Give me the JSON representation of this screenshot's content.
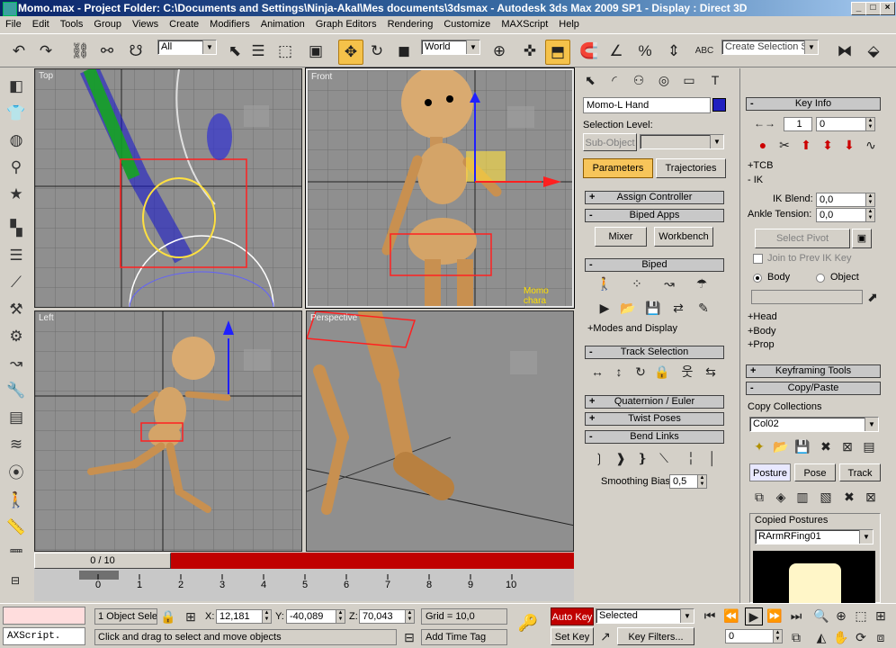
{
  "window": {
    "title": "Momo.max    - Project Folder: C:\\Documents and Settings\\Ninja-Akal\\Mes documents\\3dsmax    - Autodesk 3ds Max  2009 SP1       - Display : Direct 3D",
    "controls": [
      "_",
      "□",
      "×"
    ]
  },
  "menu": [
    "File",
    "Edit",
    "Tools",
    "Group",
    "Views",
    "Create",
    "Modifiers",
    "Animation",
    "Graph Editors",
    "Rendering",
    "Customize",
    "MAXScript",
    "Help"
  ],
  "toolbar": {
    "selection_filter": "All",
    "reference_coord": "World",
    "named_selection_placeholder": "Create Selection Set"
  },
  "viewports": {
    "top": "Top",
    "front": "Front",
    "left": "Left",
    "perspective": "Perspective",
    "front_note": "Momo chara"
  },
  "motion_panel": {
    "object_name": "Momo-L Hand",
    "object_color": "#2020c0",
    "selection_level_label": "Selection Level:",
    "sub_object": "Sub-Object",
    "tabs": {
      "parameters": "Parameters",
      "trajectories": "Trajectories"
    },
    "rollouts": {
      "assign_controller": "Assign Controller",
      "biped_apps": "Biped Apps",
      "mixer": "Mixer",
      "workbench": "Workbench",
      "biped": "Biped",
      "modes_display": "+Modes and Display",
      "track_selection": "Track Selection",
      "quaternion_euler": "Quaternion / Euler",
      "twist_poses": "Twist Poses",
      "bend_links": "Bend Links",
      "smoothing_bias_label": "Smoothing Bias:",
      "smoothing_bias_value": "0,5"
    }
  },
  "key_info": {
    "title": "Key Info",
    "key_number": "1",
    "key_time": "0",
    "tcb": "+TCB",
    "ik": "- IK",
    "ik_blend_label": "IK Blend:",
    "ik_blend_value": "0,0",
    "ankle_tension_label": "Ankle Tension:",
    "ankle_tension_value": "0,0",
    "select_pivot": "Select Pivot",
    "join_prev": "Join to Prev IK Key",
    "body": "Body",
    "object": "Object",
    "head": "+Head",
    "body2": "+Body",
    "prop": "+Prop",
    "keyframing_tools": "Keyframing Tools",
    "copy_paste": "Copy/Paste",
    "copy_collections_label": "Copy Collections",
    "collection_value": "Col02",
    "posture": "Posture",
    "pose": "Pose",
    "track": "Track",
    "copied_postures_label": "Copied Postures",
    "copied_posture_value": "RArmRFing01"
  },
  "timeline": {
    "frame_display": "0 / 10",
    "ticks": [
      "0",
      "1",
      "2",
      "3",
      "4",
      "5",
      "6",
      "7",
      "8",
      "9",
      "10"
    ]
  },
  "status": {
    "maxscript": "AXScript.",
    "selection": "1 Object Sele",
    "x_label": "X:",
    "x_value": "12,181",
    "y_label": "Y:",
    "y_value": "-40,089",
    "z_label": "Z:",
    "z_value": "70,043",
    "grid": "Grid = 10,0",
    "prompt": "Click and drag to select and move objects",
    "add_time_tag": "Add Time Tag",
    "auto_key": "Auto Key",
    "set_key": "Set Key",
    "key_filter_sel": "Selected",
    "key_filters": "Key Filters...",
    "current_frame": "0"
  }
}
